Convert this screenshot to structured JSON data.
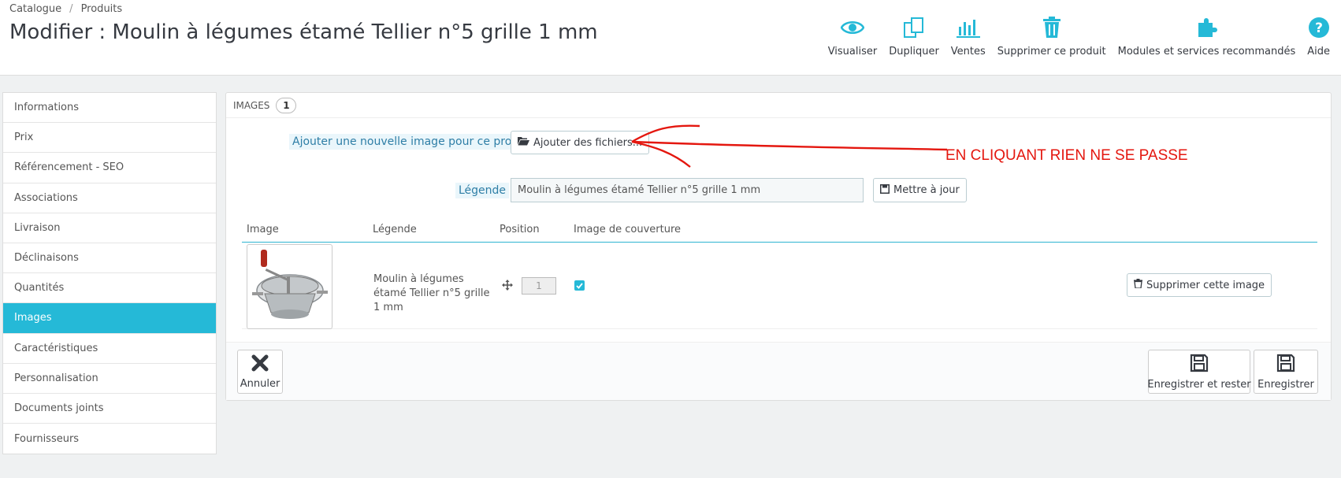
{
  "breadcrumb": {
    "items": [
      "Catalogue",
      "Produits"
    ],
    "separator": "/"
  },
  "page": {
    "title": "Modifier : Moulin à légumes étamé Tellier n°5 grille 1 mm"
  },
  "toolbar": {
    "items": [
      {
        "label": "Visualiser",
        "icon": "eye-icon"
      },
      {
        "label": "Dupliquer",
        "icon": "copy-icon"
      },
      {
        "label": "Ventes",
        "icon": "bar-chart-icon"
      },
      {
        "label": "Supprimer ce produit",
        "icon": "trash-icon"
      },
      {
        "label": "Modules et services recommandés",
        "icon": "puzzle-icon"
      },
      {
        "label": "Aide",
        "icon": "help-icon"
      }
    ]
  },
  "sidebar": {
    "items": [
      {
        "label": "Informations"
      },
      {
        "label": "Prix"
      },
      {
        "label": "Référencement - SEO"
      },
      {
        "label": "Associations"
      },
      {
        "label": "Livraison"
      },
      {
        "label": "Déclinaisons"
      },
      {
        "label": "Quantités"
      },
      {
        "label": "Images",
        "active": true
      },
      {
        "label": "Caractéristiques"
      },
      {
        "label": "Personnalisation"
      },
      {
        "label": "Documents joints"
      },
      {
        "label": "Fournisseurs"
      }
    ]
  },
  "panel": {
    "title": "IMAGES",
    "count": "1",
    "add_label": "Ajouter une nouvelle image pour ce produit",
    "add_button": "Ajouter des fichiers...",
    "legend_label": "Légende",
    "legend_value": "Moulin à légumes étamé Tellier n°5 grille 1 mm",
    "update_button": "Mettre à jour",
    "columns": [
      "Image",
      "Légende",
      "Position",
      "Image de couverture"
    ],
    "rows": [
      {
        "legend": "Moulin à légumes étamé Tellier n°5 grille 1 mm",
        "position": "1",
        "cover": true,
        "delete_label": "Supprimer cette image"
      }
    ]
  },
  "footer": {
    "cancel": "Annuler",
    "save_stay": "Enregistrer et rester",
    "save": "Enregistrer"
  },
  "annotation": {
    "text": "EN CLIQUANT RIEN NE SE PASSE",
    "color": "#e4170f"
  },
  "colors": {
    "accent": "#25b9d7",
    "title": "#363a41"
  }
}
